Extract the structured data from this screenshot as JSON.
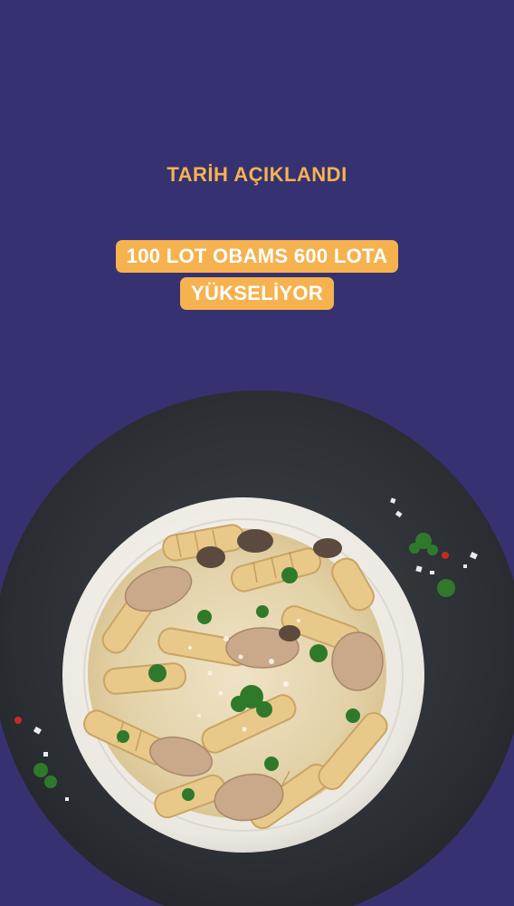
{
  "announcement": {
    "headline": "TARİH AÇIKLANDI",
    "highlight_line_1": "100 LOT OBAMS 600 LOTA",
    "highlight_line_2": "YÜKSELİYOR"
  },
  "colors": {
    "background": "#363271",
    "accent": "#f6b24f",
    "highlight_text": "#ffffff"
  },
  "image": {
    "subject": "pasta-plate-photo"
  }
}
